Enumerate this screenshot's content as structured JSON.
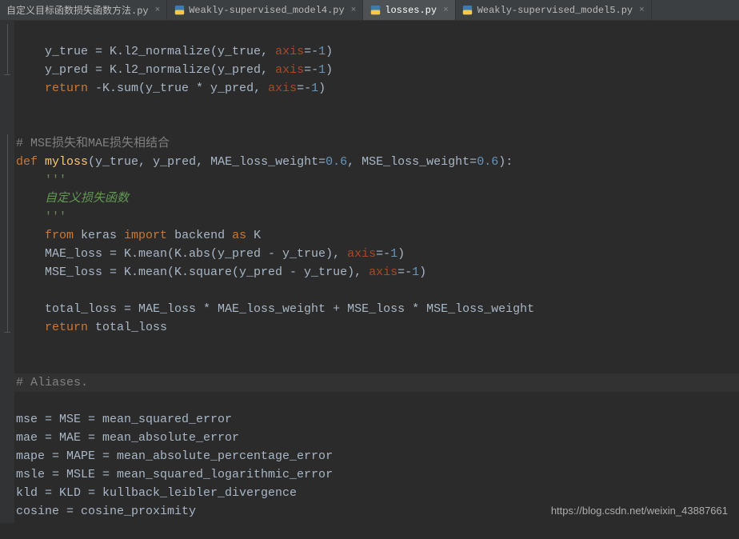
{
  "tabs": [
    {
      "label": "自定义目标函数损失函数方法.py",
      "active": false,
      "icon": false
    },
    {
      "label": "Weakly-supervised_model4.py",
      "active": false,
      "icon": true
    },
    {
      "label": "losses.py",
      "active": true,
      "icon": true
    },
    {
      "label": "Weakly-supervised_model5.py",
      "active": false,
      "icon": true
    }
  ],
  "code": {
    "line1_a": "    y_true = K.l2_normalize(y_true",
    "line1_b": ", ",
    "line1_c": "axis",
    "line1_d": "=-",
    "line1_e": "1",
    "line1_f": ")",
    "line2_a": "    y_pred = K.l2_normalize(y_pred",
    "line2_b": ", ",
    "line2_c": "axis",
    "line2_d": "=-",
    "line2_e": "1",
    "line2_f": ")",
    "line3_a": "    ",
    "line3_b": "return",
    "line3_c": " -K.sum(y_true * y_pred",
    "line3_d": ", ",
    "line3_e": "axis",
    "line3_f": "=-",
    "line3_g": "1",
    "line3_h": ")",
    "comment_mse_mae": "# MSE损失和MAE损失相结合",
    "def_kw": "def ",
    "myloss_fn": "myloss",
    "myloss_sig_a": "(y_true",
    "myloss_sig_b": ", ",
    "myloss_sig_c": "y_pred",
    "myloss_sig_d": ", ",
    "myloss_sig_e": "MAE_loss_weight=",
    "myloss_sig_f": "0.6",
    "myloss_sig_g": ", ",
    "myloss_sig_h": "MSE_loss_weight=",
    "myloss_sig_i": "0.6",
    "myloss_sig_j": "):",
    "docq1": "    '''",
    "docline": "    自定义损失函数",
    "docq2": "    '''",
    "import_a": "    ",
    "import_b": "from ",
    "import_c": "keras ",
    "import_d": "import ",
    "import_e": "backend ",
    "import_f": "as ",
    "import_g": "K",
    "mae_a": "    MAE_loss = K.mean(K.abs(y_pred - y_true)",
    "mae_b": ", ",
    "mae_c": "axis",
    "mae_d": "=-",
    "mae_e": "1",
    "mae_f": ")",
    "mse_a": "    MSE_loss = K.mean(K.square(y_pred - y_true)",
    "mse_b": ", ",
    "mse_c": "axis",
    "mse_d": "=-",
    "mse_e": "1",
    "mse_f": ")",
    "total": "    total_loss = MAE_loss * MAE_loss_weight + MSE_loss * MSE_loss_weight",
    "ret_a": "    ",
    "ret_b": "return ",
    "ret_c": "total_loss",
    "aliases_comment": "# Aliases.",
    "alias1": "mse = MSE = mean_squared_error",
    "alias2": "mae = MAE = mean_absolute_error",
    "alias3": "mape = MAPE = mean_absolute_percentage_error",
    "alias4": "msle = MSLE = mean_squared_logarithmic_error",
    "alias5": "kld = KLD = kullback_leibler_divergence",
    "alias6": "cosine = cosine_proximity"
  },
  "watermark": "https://blog.csdn.net/weixin_43887661"
}
